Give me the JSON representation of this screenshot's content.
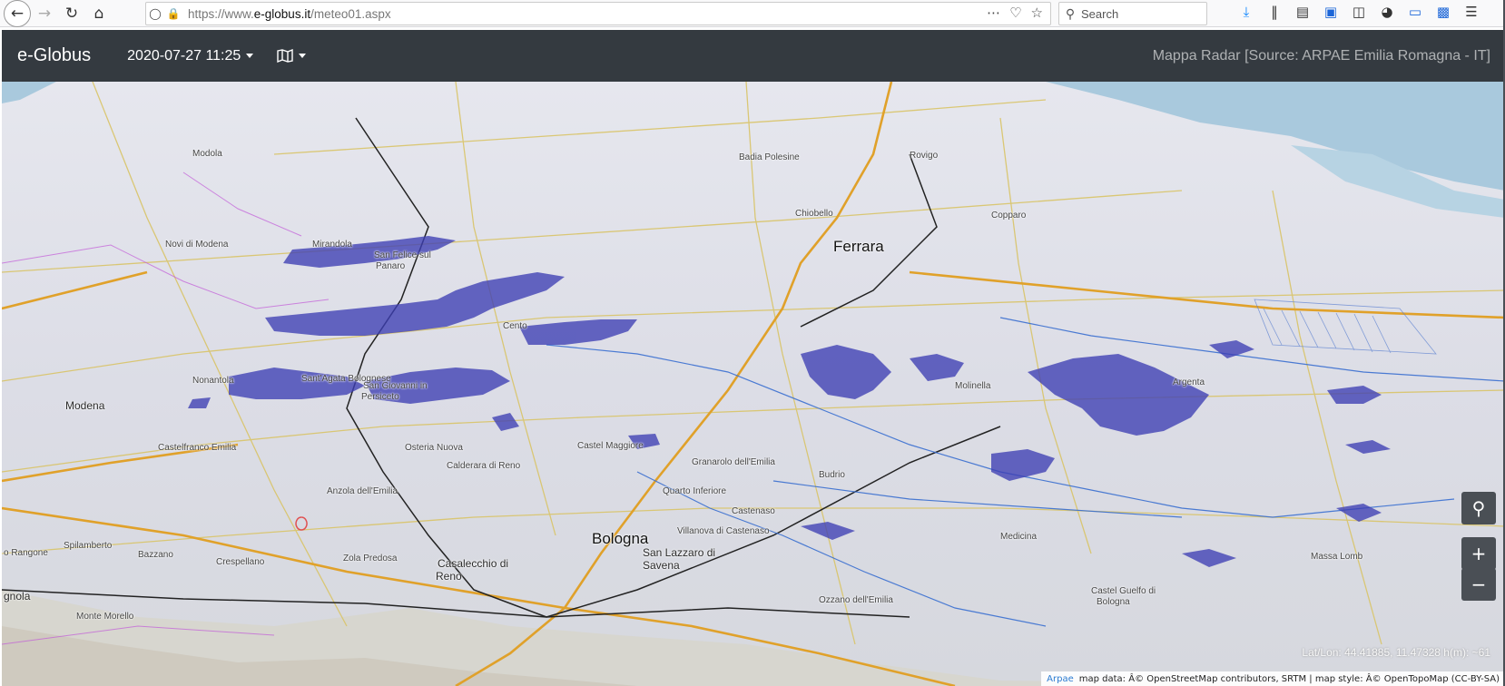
{
  "browser": {
    "url_prefix": "https://www.",
    "url_host": "e-globus.it",
    "url_path": "/meteo01.aspx",
    "search_placeholder": "Search"
  },
  "navbar": {
    "brand": "e-Globus",
    "datetime": "2020-07-27 11:25",
    "title": "Mappa Radar [Source: ARPAE Emilia Romagna - IT]"
  },
  "map": {
    "cities": {
      "ferrara": "Ferrara",
      "bologna": "Bologna",
      "modena": "Modena",
      "casalecchio": "Casalecchio di",
      "reno": "Reno",
      "san_lazzaro": "San Lazzaro di",
      "savena": "Savena",
      "castelfranco": "Castelfranco Emilia",
      "san_giovanni": "San Giovanni in",
      "persiceto": "Persiceto",
      "san_felice": "San Felice sul",
      "panaro": "Panaro",
      "mirandola": "Mirandola",
      "rovigo": "Rovigo",
      "copparo": "Copparo",
      "argenta": "Argenta",
      "medicina": "Medicina",
      "budrio": "Budrio",
      "castel_maggiore": "Castel Maggiore",
      "granarolo": "Granarolo dell'Emilia",
      "cento": "Cento",
      "anzola": "Anzola dell'Emilia",
      "zola": "Zola Predosa",
      "castenaso": "Castenaso",
      "molinella": "Molinella",
      "castel_guelfo": "Castel Guelfo di",
      "bologna2": "Bologna",
      "spilamberto": "Spilamberto",
      "castel_lago": "Calderara di Reno",
      "sant_agata": "Sant'Agata Bolognese",
      "osteria": "Osteria Nuova",
      "massa": "Massa Lomb",
      "villanova": "Villanova di Castenaso",
      "quarto": "Quarto Inferiore",
      "monte_morello": "Monte Morello",
      "nonantola": "Nonantola",
      "crespellano": "Crespellano",
      "bazzano": "Bazzano",
      "gnola": "gnola",
      "rangone": "o Rangone",
      "novi": "Novi di Modena",
      "ozzano": "Ozzano dell'Emilia",
      "medola": "Modola",
      "badia": "Badia Polesine",
      "chiobello": "Chiobello"
    },
    "coords": "Lat/Lon: 44.41885, 11.47328 h(m): ~61",
    "attribution_link": "Arpae",
    "attribution_text": "map data: Â© OpenStreetMap contributors, SRTM | map style: Â© OpenTopoMap (CC-BY-SA)",
    "controls": {
      "zoom_in": "+",
      "zoom_out": "−"
    },
    "radar_color": "#3e3fb4",
    "water_color": "#a8c8dc"
  }
}
